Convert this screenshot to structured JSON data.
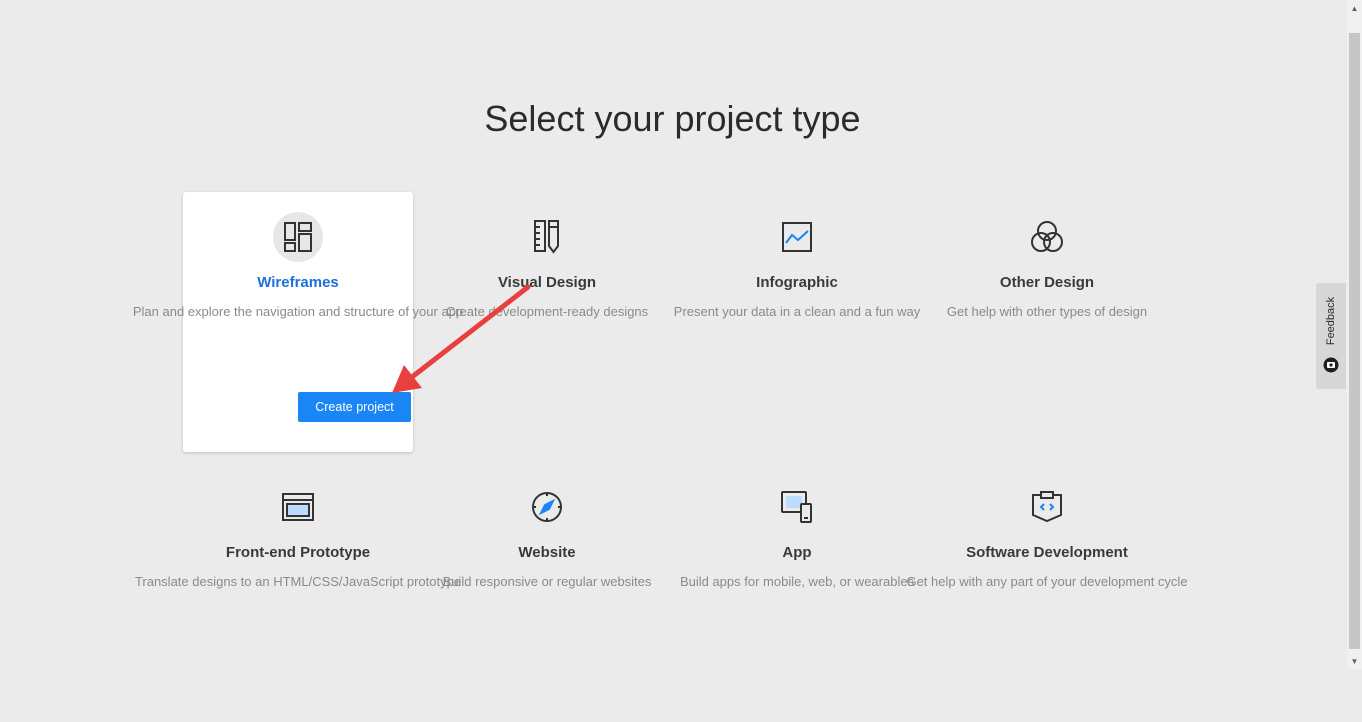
{
  "page": {
    "title": "Select your project type"
  },
  "project_types": [
    {
      "icon": "wireframes-icon",
      "title": "Wireframes",
      "description": "Plan and explore the navigation and structure of your app",
      "selected": true
    },
    {
      "icon": "ruler-pencil-icon",
      "title": "Visual Design",
      "description": "Create development-ready designs",
      "selected": false
    },
    {
      "icon": "line-chart-icon",
      "title": "Infographic",
      "description": "Present your data in a clean and a fun way",
      "selected": false
    },
    {
      "icon": "overlapping-circles-icon",
      "title": "Other Design",
      "description": "Get help with other types of design",
      "selected": false
    },
    {
      "icon": "browser-window-icon",
      "title": "Front-end Prototype",
      "description": "Translate designs to an HTML/CSS/JavaScript prototype",
      "selected": false
    },
    {
      "icon": "compass-icon",
      "title": "Website",
      "description": "Build responsive or regular websites",
      "selected": false
    },
    {
      "icon": "devices-icon",
      "title": "App",
      "description": "Build apps for mobile, web, or wearables",
      "selected": false
    },
    {
      "icon": "code-clipboard-icon",
      "title": "Software Development",
      "description": "Get help with any part of your development cycle",
      "selected": false
    }
  ],
  "actions": {
    "create_project": "Create project"
  },
  "feedback": {
    "label": "Feedback"
  },
  "colors": {
    "background": "#ebebeb",
    "accent": "#1a86f5",
    "selected_title": "#1e6fd9",
    "annotation_arrow": "#e8403f"
  }
}
